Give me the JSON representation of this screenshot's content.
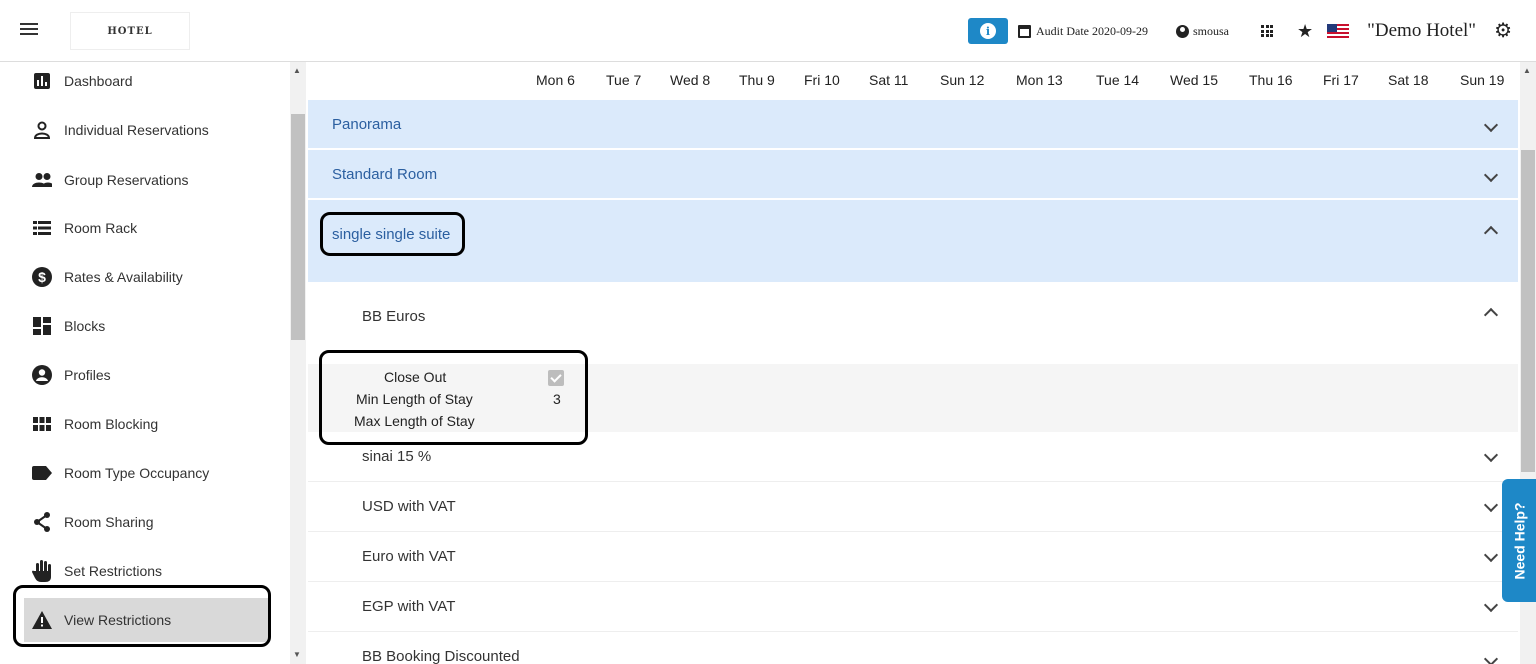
{
  "header": {
    "logo_text": "HOTEL",
    "audit_label": "Audit Date 2020-09-29",
    "user": "smousa",
    "hotel": "\"Demo Hotel\""
  },
  "sidebar": {
    "items": [
      {
        "label": "Dashboard",
        "icon": "bar-chart-icon"
      },
      {
        "label": "Individual Reservations",
        "icon": "person-icon"
      },
      {
        "label": "Group Reservations",
        "icon": "group-icon"
      },
      {
        "label": "Room Rack",
        "icon": "list-icon"
      },
      {
        "label": "Rates & Availability",
        "icon": "dollar-icon"
      },
      {
        "label": "Blocks",
        "icon": "dashboard-icon"
      },
      {
        "label": "Profiles",
        "icon": "account-circle-icon"
      },
      {
        "label": "Room Blocking",
        "icon": "apps-grid-icon"
      },
      {
        "label": "Room Type Occupancy",
        "icon": "label-icon"
      },
      {
        "label": "Room Sharing",
        "icon": "share-icon"
      },
      {
        "label": "Set Restrictions",
        "icon": "hand-icon"
      },
      {
        "label": "View Restrictions",
        "icon": "warning-icon"
      }
    ]
  },
  "days": [
    "Mon 6",
    "Tue 7",
    "Wed 8",
    "Thu 9",
    "Fri 10",
    "Sat 11",
    "Sun 12",
    "Mon 13",
    "Tue 14",
    "Wed 15",
    "Thu 16",
    "Fri 17",
    "Sat 18",
    "Sun 19"
  ],
  "room_types": [
    "Panorama",
    "Standard Room",
    "single single suite"
  ],
  "rates": {
    "expanded": "BB Euros",
    "others": [
      "sinai 15 %",
      "USD with VAT",
      "Euro with VAT",
      "EGP with VAT",
      "BB Booking Discounted"
    ]
  },
  "restrictions": {
    "close_out_label": "Close Out",
    "close_out_checked": true,
    "min_label": "Min Length of Stay",
    "min_value": "3",
    "max_label": "Max Length of Stay"
  },
  "help_label": "Need Help?"
}
